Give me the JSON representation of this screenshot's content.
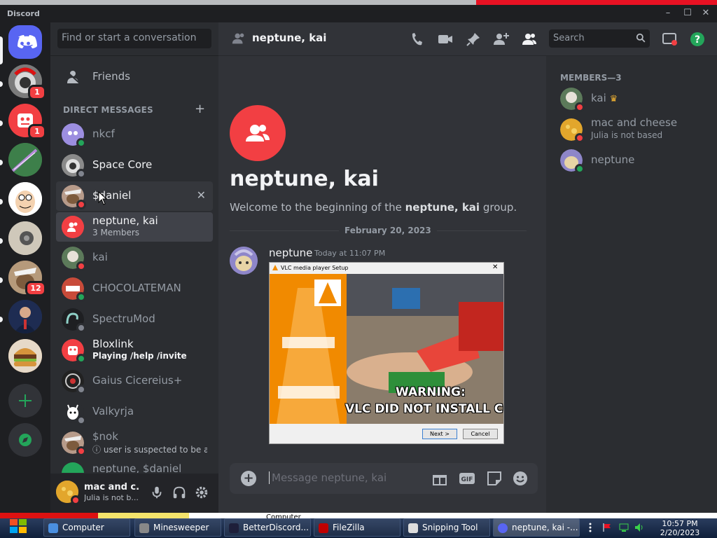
{
  "window": {
    "title": "Discord"
  },
  "servers": [
    {
      "name": "server-1",
      "badge": "1"
    },
    {
      "name": "server-2",
      "badge": "1"
    },
    {
      "name": "server-3",
      "badge": ""
    },
    {
      "name": "server-4",
      "badge": ""
    },
    {
      "name": "server-5",
      "badge": ""
    },
    {
      "name": "server-6",
      "badge": "12"
    },
    {
      "name": "server-7",
      "badge": ""
    },
    {
      "name": "server-8",
      "badge": ""
    }
  ],
  "sidebar": {
    "search_placeholder": "Find or start a conversation",
    "friends_label": "Friends",
    "dm_header": "DIRECT MESSAGES",
    "dms": [
      {
        "name": "nkcf",
        "sub": "",
        "status": "online"
      },
      {
        "name": "Space Core",
        "sub": "",
        "status": "offline"
      },
      {
        "name": "$daniel",
        "sub": "",
        "status": "dnd"
      },
      {
        "name": "neptune, kai",
        "sub": "3 Members",
        "status": "group"
      },
      {
        "name": "kai",
        "sub": "",
        "status": "dnd"
      },
      {
        "name": "CHOCOLATEMAN",
        "sub": "",
        "status": "online"
      },
      {
        "name": "SpectruMod",
        "sub": "",
        "status": "offline"
      },
      {
        "name": "Bloxlink",
        "sub": "Playing /help /invite",
        "status": "online"
      },
      {
        "name": "Gaius Cicereius+",
        "sub": "",
        "status": "offline"
      },
      {
        "name": "Valkyrja",
        "sub": "",
        "status": "offline"
      },
      {
        "name": "$nok",
        "sub": "ⓘ user is suspected to be a p...",
        "status": "dnd"
      },
      {
        "name": "neptune, $daniel",
        "sub": "",
        "status": "group"
      }
    ]
  },
  "user_panel": {
    "name": "mac and c...",
    "status": "Julia is not b..."
  },
  "header": {
    "channel_name": "neptune, kai",
    "search_placeholder": "Search"
  },
  "chat": {
    "group_title": "neptune, kai",
    "welcome_prefix": "Welcome to the beginning of the ",
    "welcome_name": "neptune, kai",
    "welcome_suffix": " group.",
    "date_divider": "February 20, 2023",
    "message": {
      "author": "neptune",
      "time": "Today at 11:07 PM",
      "attachment": {
        "window_title": "VLC media player Setup",
        "warning_line1": "WARNING:",
        "warning_line2": "VLC DID NOT INSTALL CORRECTLY",
        "next_btn": "Next >",
        "cancel_btn": "Cancel"
      }
    },
    "composer_placeholder": "Message neptune, kai"
  },
  "members": {
    "header": "MEMBERS—3",
    "list": [
      {
        "name": "kai",
        "sub": "",
        "status": "dnd"
      },
      {
        "name": "mac and cheese",
        "sub": "Julia is not based",
        "status": "dnd"
      },
      {
        "name": "neptune",
        "sub": "",
        "status": "online"
      }
    ]
  },
  "taskbar": {
    "strip_text": "Computer",
    "items": [
      {
        "label": "Computer"
      },
      {
        "label": "Minesweeper"
      },
      {
        "label": "BetterDiscord..."
      },
      {
        "label": "FileZilla"
      },
      {
        "label": "Snipping Tool"
      },
      {
        "label": "neptune, kai -..."
      }
    ],
    "clock_time": "10:57 PM",
    "clock_date": "2/20/2023"
  },
  "colors": {
    "accent": "#5865f2",
    "online": "#23a55a",
    "dnd": "#f23f43",
    "group": "#f23f43"
  }
}
